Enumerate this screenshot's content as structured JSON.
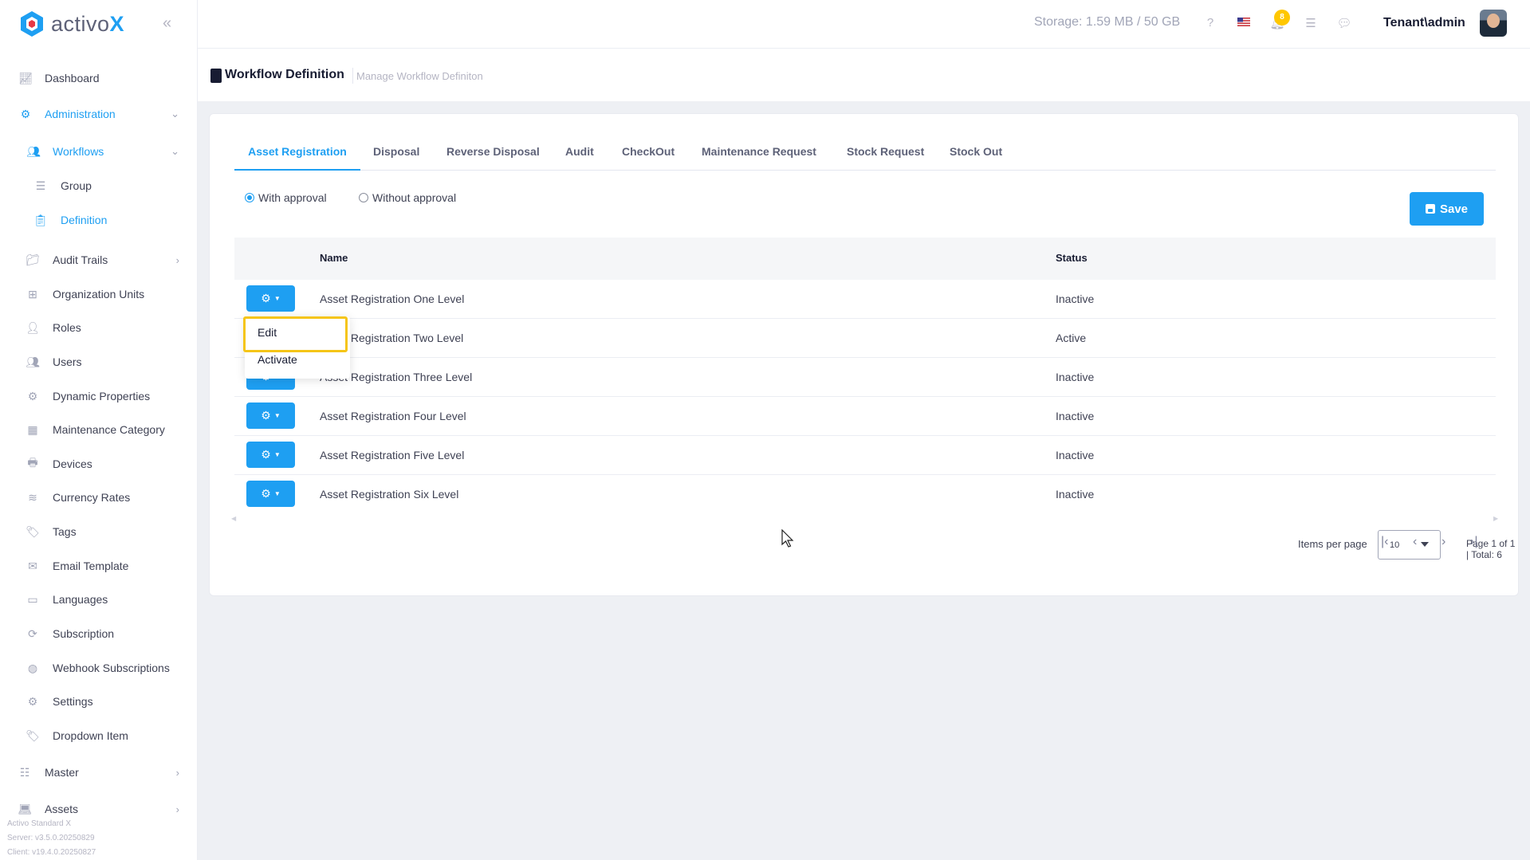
{
  "brand": {
    "name_prefix": "activo",
    "name_suffix": "X"
  },
  "sidebar": {
    "items": [
      {
        "label": "Dashboard"
      },
      {
        "label": "Administration"
      },
      {
        "label": "Workflows"
      },
      {
        "label": "Group"
      },
      {
        "label": "Definition"
      },
      {
        "label": "Audit Trails"
      },
      {
        "label": "Organization Units"
      },
      {
        "label": "Roles"
      },
      {
        "label": "Users"
      },
      {
        "label": "Dynamic Properties"
      },
      {
        "label": "Maintenance Category"
      },
      {
        "label": "Devices"
      },
      {
        "label": "Currency Rates"
      },
      {
        "label": "Tags"
      },
      {
        "label": "Email Template"
      },
      {
        "label": "Languages"
      },
      {
        "label": "Subscription"
      },
      {
        "label": "Webhook Subscriptions"
      },
      {
        "label": "Settings"
      },
      {
        "label": "Dropdown Item"
      },
      {
        "label": "Master"
      },
      {
        "label": "Assets"
      }
    ],
    "footer": {
      "product": "Activo Standard X",
      "server": "Server: v3.5.0.20250829",
      "client": "Client: v19.4.0.20250827"
    }
  },
  "header": {
    "storage": "Storage: 1.59 MB / 50 GB",
    "notification_count": "8",
    "user": "Tenant\\admin"
  },
  "subheader": {
    "title": "Workflow Definition",
    "description": "Manage Workflow Definiton"
  },
  "tabs": [
    {
      "label": "Asset Registration"
    },
    {
      "label": "Disposal"
    },
    {
      "label": "Reverse Disposal"
    },
    {
      "label": "Audit"
    },
    {
      "label": "CheckOut"
    },
    {
      "label": "Maintenance Request"
    },
    {
      "label": "Stock Request"
    },
    {
      "label": "Stock Out"
    }
  ],
  "approval": {
    "with_label": "With approval",
    "without_label": "Without approval",
    "selected": "With approval"
  },
  "save_label": "Save",
  "table": {
    "headers": {
      "name": "Name",
      "status": "Status"
    },
    "rows": [
      {
        "name": "Asset Registration One Level",
        "status": "Inactive"
      },
      {
        "name": "Asset Registration Two Level",
        "status": "Active"
      },
      {
        "name": "Asset Registration Three Level",
        "status": "Inactive"
      },
      {
        "name": "Asset Registration Four Level",
        "status": "Inactive"
      },
      {
        "name": "Asset Registration Five Level",
        "status": "Inactive"
      },
      {
        "name": "Asset Registration Six Level",
        "status": "Inactive"
      }
    ]
  },
  "dropdown": {
    "edit": "Edit",
    "activate": "Activate"
  },
  "pagination": {
    "items_per_page_label": "Items per page",
    "items_per_page": "10",
    "info": "Page 1 of 1 | Total: 6"
  },
  "colors": {
    "accent": "#1e9ff2",
    "highlight": "#f5c518",
    "badge": "#ffc700"
  }
}
